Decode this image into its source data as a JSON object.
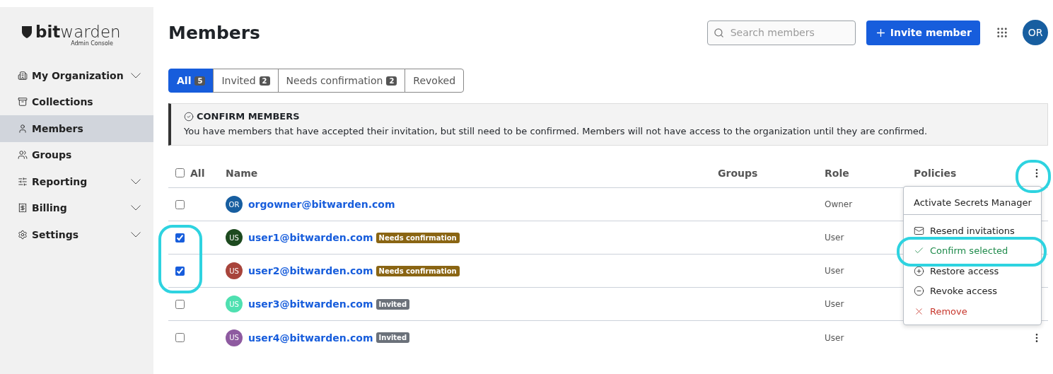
{
  "sidebar": {
    "logo": {
      "bold": "bit",
      "light": "warden",
      "subtitle": "Admin Console"
    },
    "items": [
      {
        "label": "My Organization",
        "expandable": true,
        "selected": false
      },
      {
        "label": "Collections",
        "expandable": false,
        "selected": false
      },
      {
        "label": "Members",
        "expandable": false,
        "selected": true
      },
      {
        "label": "Groups",
        "expandable": false,
        "selected": false
      },
      {
        "label": "Reporting",
        "expandable": true,
        "selected": false
      },
      {
        "label": "Billing",
        "expandable": true,
        "selected": false
      },
      {
        "label": "Settings",
        "expandable": true,
        "selected": false
      }
    ]
  },
  "header": {
    "title": "Members",
    "search": {
      "placeholder": "Search members"
    },
    "invite_button": "Invite member",
    "avatar": "OR"
  },
  "tabs": [
    {
      "label": "All",
      "count": "5",
      "selected": true
    },
    {
      "label": "Invited",
      "count": "2",
      "selected": false
    },
    {
      "label": "Needs confirmation",
      "count": "2",
      "selected": false
    },
    {
      "label": "Revoked",
      "selected": false
    }
  ],
  "callout": {
    "title": "CONFIRM MEMBERS",
    "text": "You have members that have accepted their invitation, but still need to be confirmed. Members will not have access to the organization until they are confirmed."
  },
  "table": {
    "select_all": {
      "label": "All",
      "checked": false
    },
    "columns": [
      "Name",
      "Groups",
      "Role",
      "Policies"
    ],
    "rows": [
      {
        "checked": false,
        "initials": "OR",
        "color": "#175ea0",
        "email": "orgowner@bitwarden.com",
        "role": "Owner",
        "menu_button": false
      },
      {
        "checked": true,
        "initials": "US",
        "color": "#1d4a1f",
        "email": "user1@bitwarden.com",
        "badge": {
          "label": "Needs confirmation",
          "kind": "warning"
        },
        "role": "User",
        "menu_button": false
      },
      {
        "checked": true,
        "initials": "US",
        "color": "#a8443b",
        "email": "user2@bitwarden.com",
        "badge": {
          "label": "Needs confirmation",
          "kind": "warning"
        },
        "role": "User",
        "menu_button": false
      },
      {
        "checked": false,
        "initials": "US",
        "color": "#4fe0b0",
        "email": "user3@bitwarden.com",
        "badge": {
          "label": "Invited",
          "kind": "neutral"
        },
        "role": "User",
        "menu_button": false
      },
      {
        "checked": false,
        "initials": "US",
        "color": "#8e5aa0",
        "email": "user4@bitwarden.com",
        "badge": {
          "label": "Invited",
          "kind": "neutral"
        },
        "role": "User",
        "menu_button": true
      }
    ]
  },
  "menu": {
    "items": [
      {
        "label": "Activate Secrets Manager",
        "kind": "plain"
      },
      {
        "label": "Resend invitations",
        "kind": "mail"
      },
      {
        "label": "Confirm selected",
        "kind": "confirm"
      },
      {
        "label": "Restore access",
        "kind": "restore"
      },
      {
        "label": "Revoke access",
        "kind": "revoke"
      },
      {
        "label": "Remove",
        "kind": "danger"
      }
    ]
  }
}
